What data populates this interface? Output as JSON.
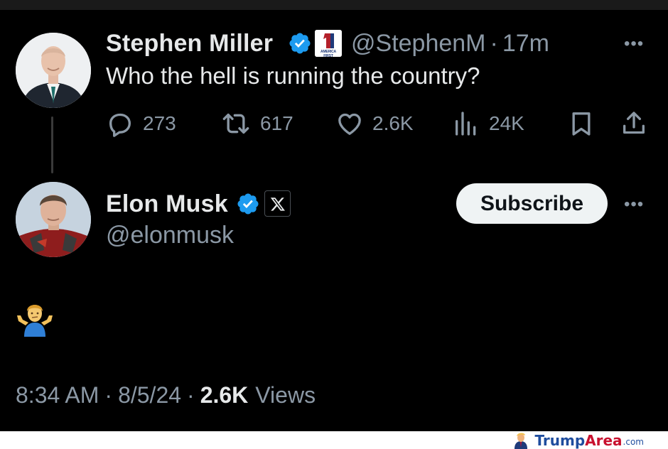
{
  "tweet1": {
    "author_name": "Stephen Miller",
    "handle": "@StephenM",
    "separator": "·",
    "time": "17m",
    "text": "Who the hell is running the country?",
    "affiliate_badge_text": "AMERICA FIRST",
    "affiliate_badge_number": "1",
    "actions": {
      "replies": "273",
      "reposts": "617",
      "likes": "2.6K",
      "views": "24K"
    },
    "more_label": "•••"
  },
  "tweet2": {
    "author_name": "Elon Musk",
    "handle": "@elonmusk",
    "subscribe_label": "Subscribe",
    "more_label": "•••",
    "content_emoji": "person-shrugging-emoji",
    "time": "8:34 AM",
    "sep1": "·",
    "date": "8/5/24",
    "sep2": "·",
    "views_count": "2.6K",
    "views_label": "Views"
  },
  "watermark": {
    "part1": "Trump",
    "part2": "Area",
    "part3": ".com"
  },
  "colors": {
    "background": "#000000",
    "text_primary": "#e7e9ea",
    "text_secondary": "#8b98a5",
    "verified_blue": "#1d9bf0",
    "subscribe_bg": "#eff3f4"
  },
  "icons": [
    "reply-icon",
    "repost-icon",
    "like-icon",
    "views-icon",
    "bookmark-icon",
    "share-icon",
    "verified-icon",
    "x-logo-icon",
    "more-icon"
  ]
}
